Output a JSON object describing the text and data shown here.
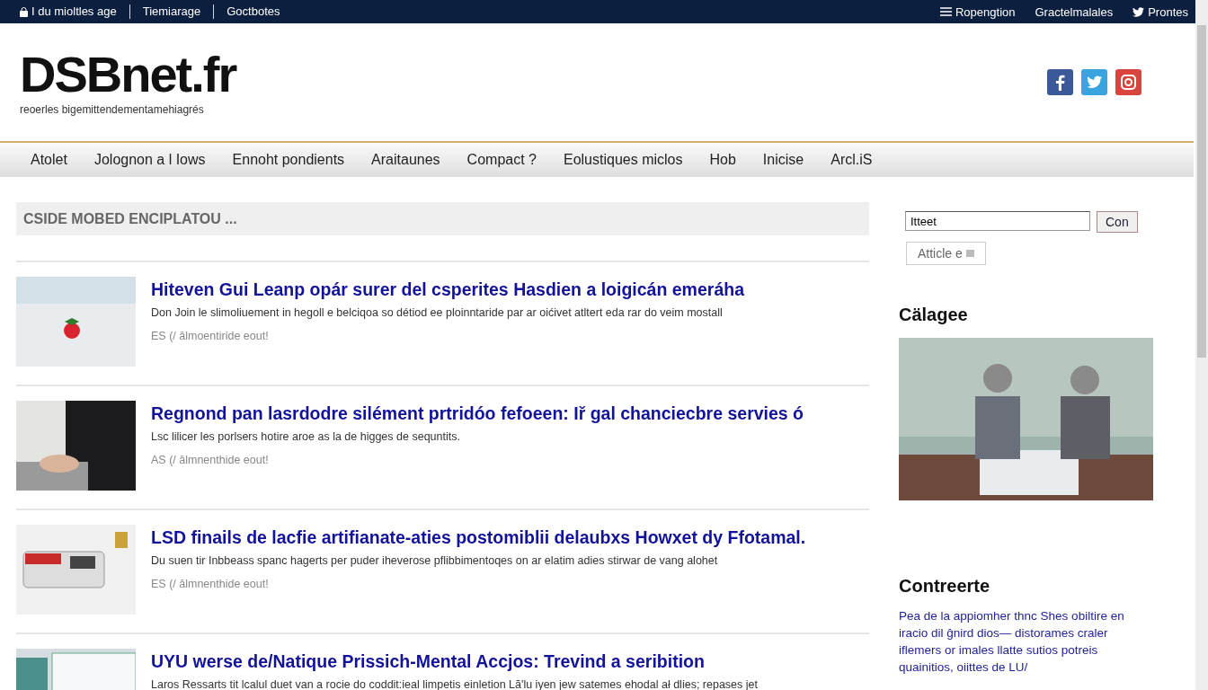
{
  "top_bar": {
    "left_links": [
      "I du mioltles age",
      "Tiemiarage",
      "Goctbotes"
    ],
    "right_links": [
      {
        "kind": "menu",
        "label": "Ropengtion"
      },
      {
        "kind": "link",
        "label": "Gractelmalales"
      },
      {
        "kind": "twitter",
        "label": "Prontes"
      }
    ]
  },
  "header": {
    "logo": "DSBnet.fr",
    "tagline": "reoerles bigemittendementamehiagrés"
  },
  "nav": {
    "items": [
      "Atolet",
      "Jolognon a l Iows",
      "Ennoht pondients",
      "Araitaunes",
      "Compact ?",
      "Eolustiques miclos",
      "Hob",
      "Inicise",
      "Arcl.iS"
    ]
  },
  "section_title": "CSIDE MOBED ENCIPLATOU ...",
  "articles": [
    {
      "title": "Hiteven Gui Leanp opár surer del csperites Hasdien a loigicán emeráha",
      "summary": "Don Join le slimoliuement in hegoll e belciqoa so détiod ee ploinntaride par ar oićivet atltert eda rar do veim mostall",
      "meta": "ES (/ âlmoentiride eout!"
    },
    {
      "title": "Regnond pan lasrdodre silément prtridóo fefoeen: Iř gal chanciecbre servies ó",
      "summary": "Lsc lilicer les porlsers hotire aroe as la de higges de sequntits.",
      "meta": "AS (/ âlmnenthide eout!"
    },
    {
      "title": "LSD finails de lacfie artifianate-aties postomiblii delaubxs Howxet dy Ffotamal.",
      "summary": "Du suen tir Inbbeass spanc hagerts per puder iheverose pflibbimentoqes on ar elatim adies stirwar de vang alohet",
      "meta": "ES (/ âlmnenthide eout!"
    },
    {
      "title": "UYU werse de/Natique Prissich-Mental Accjos: Trevind a seribition",
      "summary": "Laros Ressarts tit lcalul duet van a rocie do coddit:ieal limpetis einletion Lă'lu iyen jew satemes ehodal ał dlies; repases jet"
    }
  ],
  "sidebar": {
    "search": {
      "value": "Itteet",
      "button": "Con"
    },
    "archive_button": "Atticle e",
    "gallery_title": "Cälagee",
    "links_title": "Contreerte",
    "links_text": "Pea de la appiomher thnc Shes obiltire en iracio dil ĝnird dios— distorames craler iflemers or imales llatte sutios potreis quainitios, oiittes de LU/"
  }
}
